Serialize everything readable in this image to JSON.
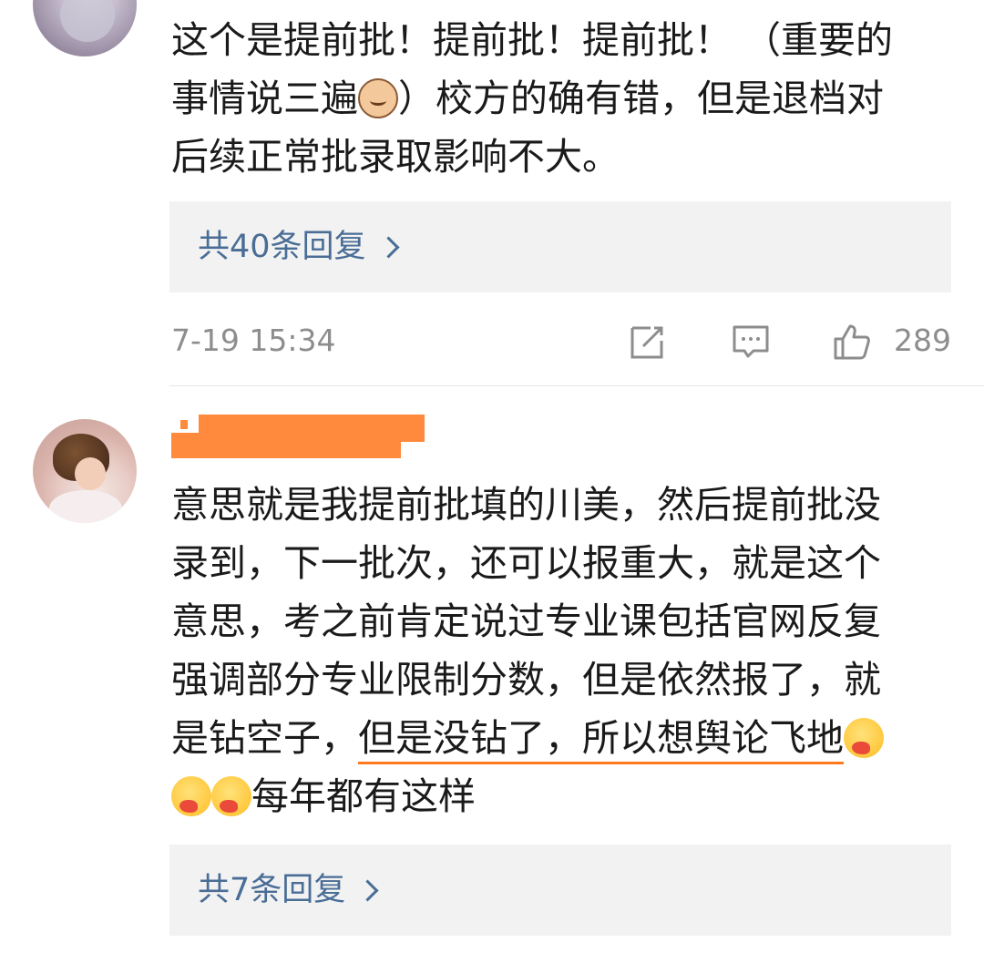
{
  "comment1": {
    "text_line1": "这个是提前批！提前批！提前批！ （重要的",
    "text_line2_before_emoji": "事情说三遍",
    "emoji1": "cat-face-emoji",
    "text_line2_after_emoji": "）校方的确有错，但是退档对",
    "text_line3": "后续正常批录取影响不大。",
    "reply_label": "共40条回复",
    "timestamp": "7-19 15:34",
    "like_count": "289"
  },
  "comment2": {
    "text_lines": [
      "意思就是我提前批填的川美，然后提前批没",
      "录到，下一批次，还可以报重大，就是这个",
      "意思，考之前肯定说过专业课包括官网反复",
      "强调部分专业限制分数，但是依然报了，就"
    ],
    "text_line5_plain": "是钻空子，",
    "text_line5_underlined": "但是没钻了，所以想舆论飞地",
    "text_line6": "每年都有这样",
    "emoji_name": "thinking-face-emoji",
    "reply_label": "共7条回复"
  },
  "colors": {
    "link": "#4a6d96",
    "meta": "#8d8d8d",
    "reply_bg": "#f2f2f2",
    "highlight": "#ff7a1f"
  }
}
